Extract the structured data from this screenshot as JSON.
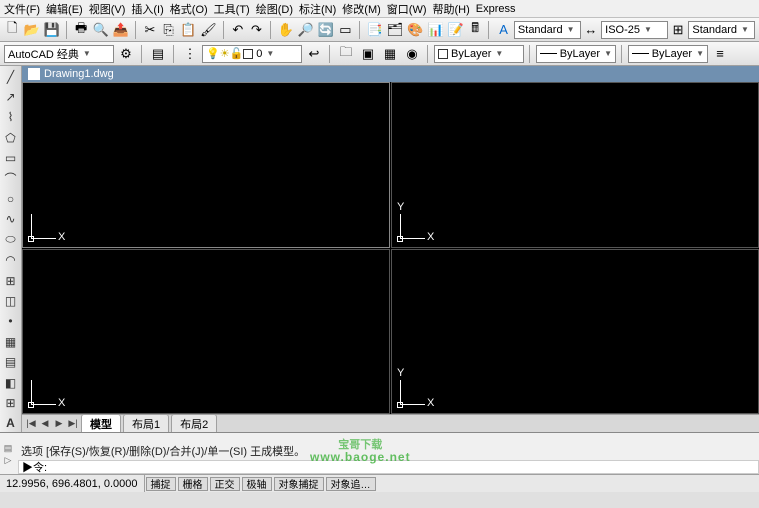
{
  "menu": {
    "items": [
      "文件(F)",
      "编辑(E)",
      "视图(V)",
      "插入(I)",
      "格式(O)",
      "工具(T)",
      "绘图(D)",
      "标注(N)",
      "修改(M)",
      "窗口(W)",
      "帮助(H)",
      "Express"
    ]
  },
  "toolbar1": {
    "workspace": "AutoCAD 经典",
    "text_style": "Standard",
    "dim_style": "ISO-25",
    "std2": "Standard"
  },
  "toolbar2": {
    "layer": "0",
    "color": "ByLayer",
    "linetype": "ByLayer",
    "weight": "ByLayer"
  },
  "doc": {
    "title": "Drawing1.dwg"
  },
  "ucs": {
    "x": "X",
    "y": "Y"
  },
  "tabs": {
    "nav": [
      "|◀",
      "◀",
      "▶",
      "▶|"
    ],
    "items": [
      "模型",
      "布局1",
      "布局2"
    ]
  },
  "command": {
    "history": "选项 [保存(S)/恢复(R)/删除(D)/合并(J)/单一(SI)                          王成模型。",
    "prompt": "▶令:"
  },
  "status": {
    "coords": "12.9956,  696.4801, 0.0000",
    "toggles": [
      "捕捉",
      "栅格",
      "正交",
      "极轴",
      "对象捕捉",
      "对象追…"
    ]
  },
  "watermark": {
    "text": "宝哥下载",
    "url": "www.baoge.net"
  }
}
